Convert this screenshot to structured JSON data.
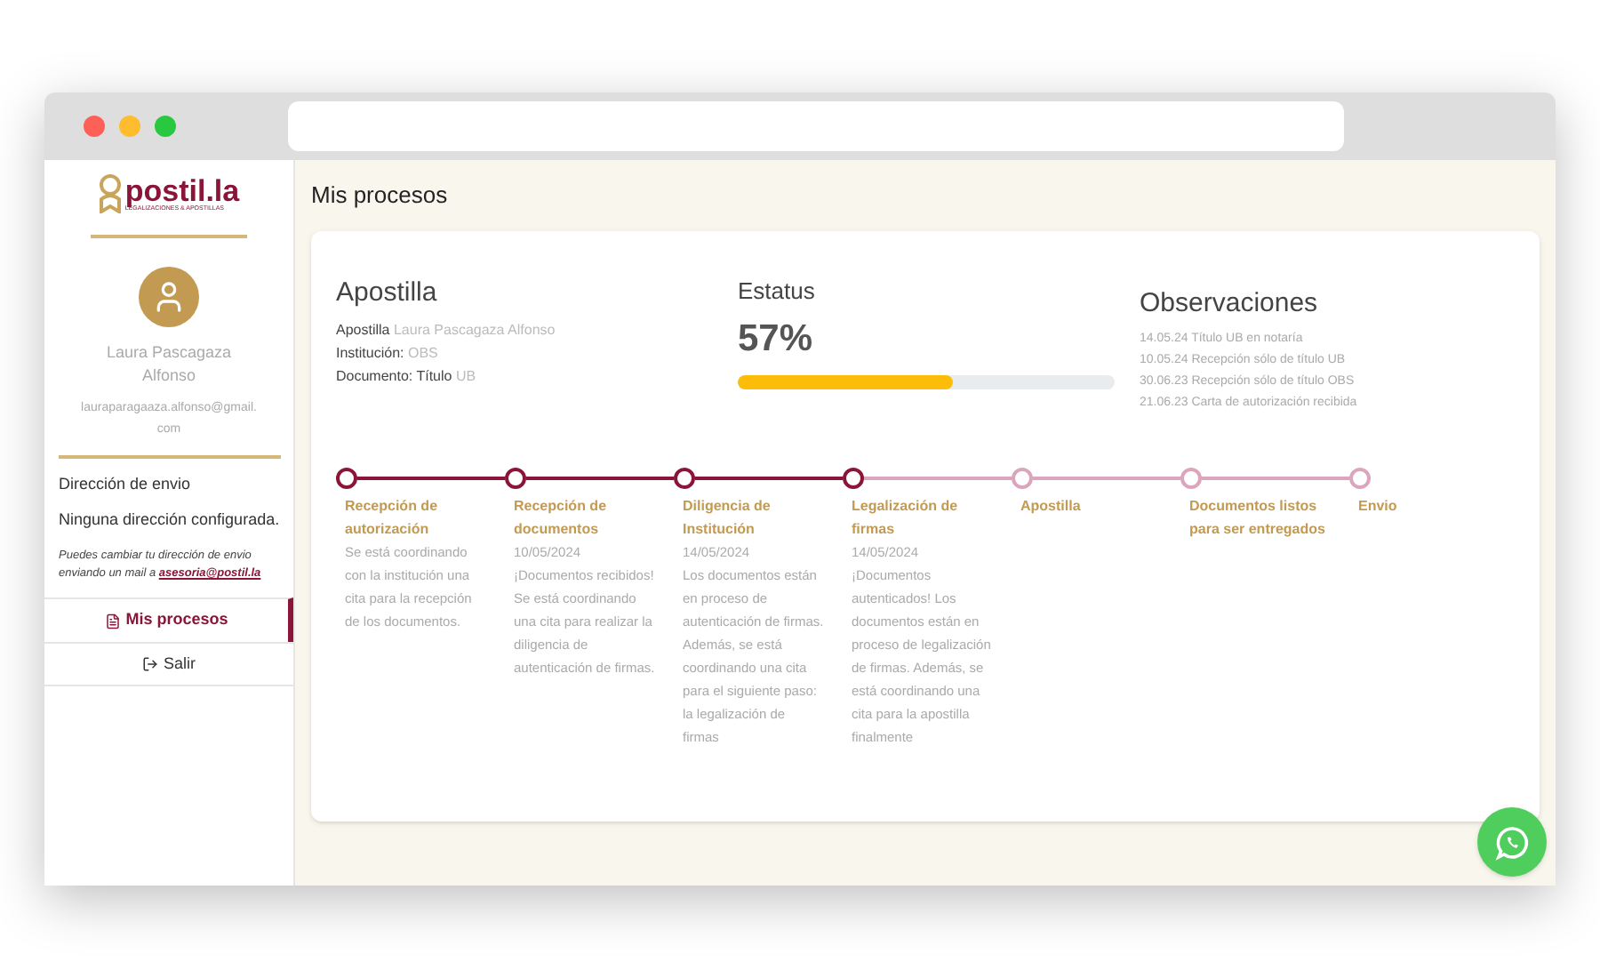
{
  "sidebar": {
    "logo": {
      "name": "postil.la",
      "tagline": "LEGALIZACIONES & APOSTILLAS"
    },
    "user": {
      "name": "Laura Pascagaza Alfonso",
      "email": "lauraparagaaza.alfonso@gmail.com"
    },
    "address": {
      "label": "Dirección de envio",
      "value": "Ninguna dirección configurada.",
      "note": "Puedes cambiar tu dirección de envio enviando un mail a",
      "email": "asesoria@postil.la"
    },
    "nav": [
      {
        "label": "Mis procesos",
        "kind": "document",
        "selected": true
      },
      {
        "label": "Salir",
        "kind": "exit",
        "selected": false
      }
    ]
  },
  "page_title": "Mis procesos",
  "process": {
    "title": "Apostilla",
    "details": [
      {
        "label": "Apostilla",
        "value": "Laura Pascagaza Alfonso"
      },
      {
        "label": "Institución:",
        "value": "OBS"
      },
      {
        "label": "Documento: Título",
        "value": "UB"
      }
    ],
    "status": {
      "label": "Estatus",
      "percent": "57%",
      "level": 0.57
    },
    "observations": {
      "title": "Observaciones",
      "items": [
        "14.05.24 Título UB en notaría",
        "10.05.24 Recepción sólo de título UB",
        "30.06.23 Recepción sólo de título OBS",
        "21.06.23 Carta de autorización recibida"
      ]
    },
    "steps": [
      {
        "title": "Recepción de autorización",
        "done": true,
        "text": "Se está coordinando con la institución una cita para la recepción de los documentos."
      },
      {
        "title": "Recepción de documentos",
        "done": true,
        "date": "10/05/2024",
        "text": "¡Documentos recibidos! Se está coordinando una cita para realizar la diligencia de autenticación de firmas."
      },
      {
        "title": "Diligencia de Institución",
        "done": true,
        "date": "14/05/2024",
        "text": "Los documentos están en proceso de autenticación de firmas. Además, se está coordinando una cita para el siguiente paso: la legalización de firmas"
      },
      {
        "title": "Legalización de firmas",
        "done": true,
        "date": "14/05/2024",
        "text": "¡Documentos autenticados! Los documentos están en proceso de legalización de firmas. Además, se está coordinando una cita para la apostilla finalmente"
      },
      {
        "title": "Apostilla",
        "done": false
      },
      {
        "title": "Documentos listos para ser entregados",
        "done": false
      },
      {
        "title": "Envio",
        "done": false
      }
    ]
  }
}
